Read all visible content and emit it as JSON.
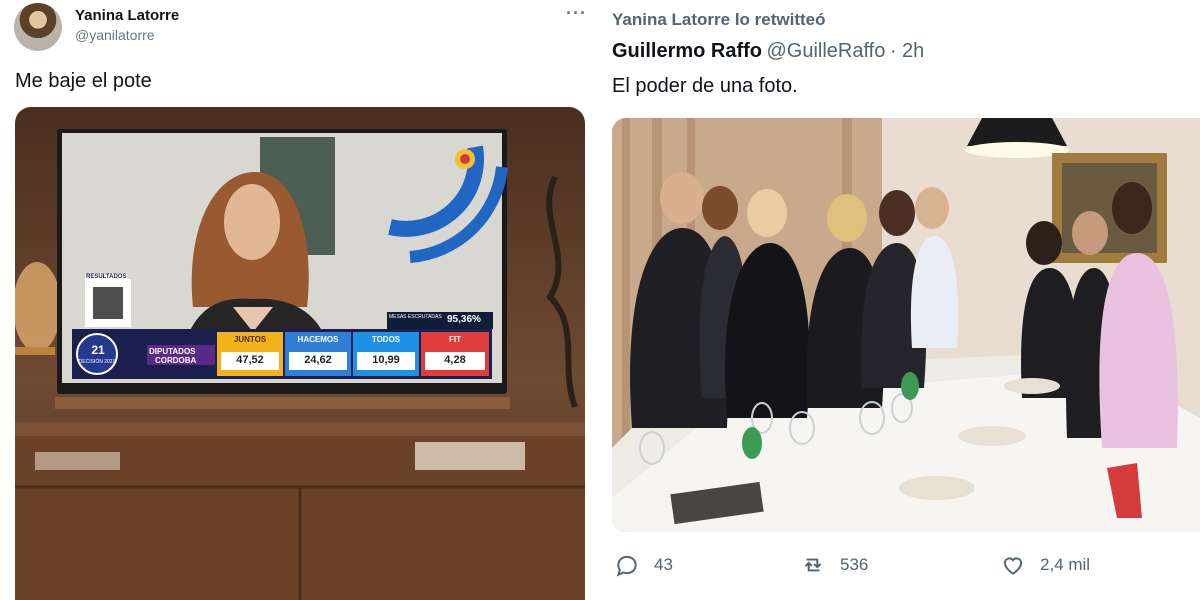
{
  "left_tweet": {
    "author_name": "Yanina Latorre",
    "author_handle": "@yanilatorre",
    "text": "Me baje el pote",
    "tv": {
      "box_label": "RESULTADOS",
      "eleccion": "21",
      "eleccion_sub": "DECISIÓN 2021",
      "district_line1": "DIPUTADOS",
      "district_line2": "CORDOBA",
      "mesas_label": "MESAS ESCRUTADAS",
      "mesas_value": "95,36%",
      "results": [
        {
          "label": "JUNTOS",
          "value": "47,52",
          "sub": "JUNTOS",
          "color": "#f2b31a"
        },
        {
          "label": "HACEMOS",
          "value": "24,62",
          "sub": "HACEMOS",
          "color": "#2f7ed8"
        },
        {
          "label": "TODOS",
          "value": "10,99",
          "sub": "TODOS",
          "color": "#1e90e6"
        },
        {
          "label": "FIT",
          "value": "4,28",
          "sub": "FIT",
          "color": "#e23b3b"
        }
      ]
    }
  },
  "right_tweet": {
    "retweet_line": "Yanina Latorre lo retwitteó",
    "author_name": "Guillermo Raffo",
    "author_handle": "@GuilleRaffo",
    "time": "2h",
    "text": "El poder de una foto.",
    "actions": {
      "replies": "43",
      "retweets": "536",
      "likes": "2,4 mil"
    }
  },
  "colors": {
    "secondary_text": "#536471",
    "divider": "#e8ecef"
  }
}
